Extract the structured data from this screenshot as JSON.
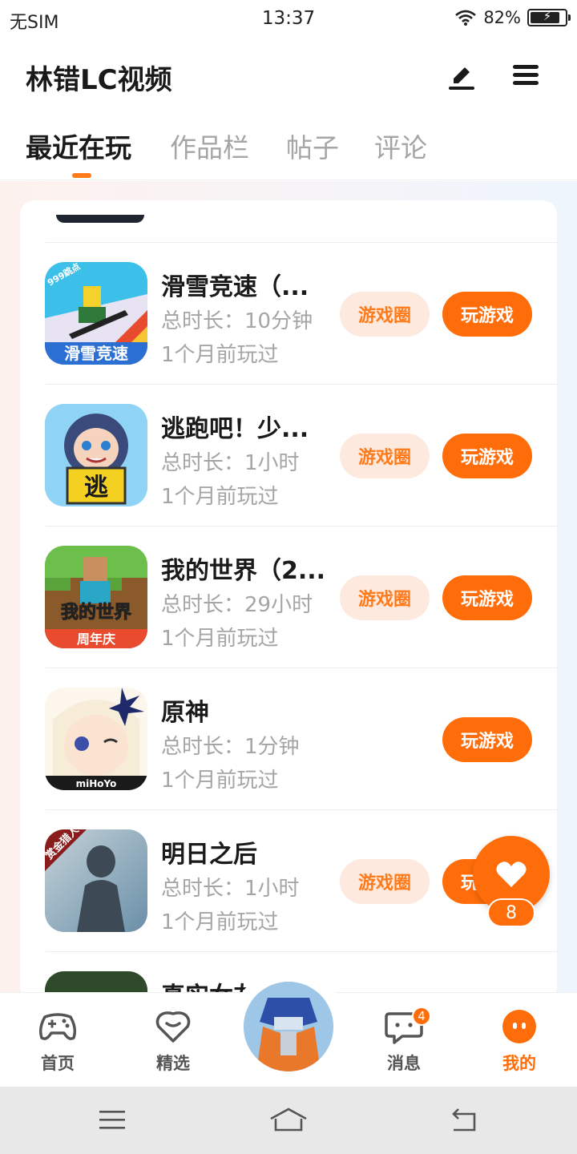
{
  "status_bar": {
    "carrier": "无SIM",
    "time": "13:37",
    "battery": "82%",
    "battery_level": 0.82,
    "icons": [
      "wifi-icon",
      "battery-charging-icon"
    ]
  },
  "header": {
    "title": "林错LC视频",
    "icons": [
      "pen-icon",
      "menu-icon"
    ]
  },
  "tabs": [
    {
      "label": "最近在玩",
      "active": true
    },
    {
      "label": "作品栏",
      "active": false
    },
    {
      "label": "帖子",
      "active": false
    },
    {
      "label": "评论",
      "active": false
    }
  ],
  "games": [
    {
      "name": "滑雪竞速（...",
      "duration": "总时长：10分钟",
      "last_played": "1个月前玩过",
      "circle_label": "游戏圈",
      "play_label": "玩游戏",
      "icon": "ski-race-icon",
      "icon_text": "滑雪竞速",
      "icon_badge": "999跳点"
    },
    {
      "name": "逃跑吧！少...",
      "duration": "总时长：1小时",
      "last_played": "1个月前玩过",
      "circle_label": "游戏圈",
      "play_label": "玩游戏",
      "icon": "escape-game-icon",
      "icon_text": "逃"
    },
    {
      "name": "我的世界（2...",
      "duration": "总时长：29小时",
      "last_played": "1个月前玩过",
      "circle_label": "游戏圈",
      "play_label": "玩游戏",
      "icon": "minecraft-icon",
      "icon_text": "我的世界",
      "icon_badge": "周年庆"
    },
    {
      "name": "原神",
      "duration": "总时长：1分钟",
      "last_played": "1个月前玩过",
      "circle_label": "",
      "play_label": "玩游戏",
      "icon": "genshin-icon",
      "icon_text": "miHoYo"
    },
    {
      "name": "明日之后",
      "duration": "总时长：1小时",
      "last_played": "1个月前玩过",
      "circle_label": "游戏圈",
      "play_label": "玩游戏",
      "icon": "lifeafter-icon",
      "icon_badge": "赏金猎人"
    },
    {
      "name": "真实女友",
      "duration": "",
      "last_played": "",
      "circle_label": "",
      "play_label": "",
      "icon": "partial-game-icon"
    }
  ],
  "float_like": {
    "icon": "heart-icon",
    "count": "8"
  },
  "bottom_nav": [
    {
      "label": "首页",
      "icon": "gamepad-icon",
      "active": false
    },
    {
      "label": "精选",
      "icon": "featured-heart-icon",
      "active": false
    },
    {
      "label": "",
      "icon": "center-avatar",
      "active": false
    },
    {
      "label": "消息",
      "icon": "message-icon",
      "active": false,
      "badge": "4"
    },
    {
      "label": "我的",
      "icon": "profile-icon",
      "active": true
    }
  ],
  "system_nav": [
    "recent-apps-icon",
    "home-icon",
    "back-icon"
  ],
  "colors": {
    "accent": "#ff6d0a",
    "accent_light": "#fde9dd",
    "text_primary": "#1a1a1a",
    "text_secondary": "#a5a5a5"
  }
}
